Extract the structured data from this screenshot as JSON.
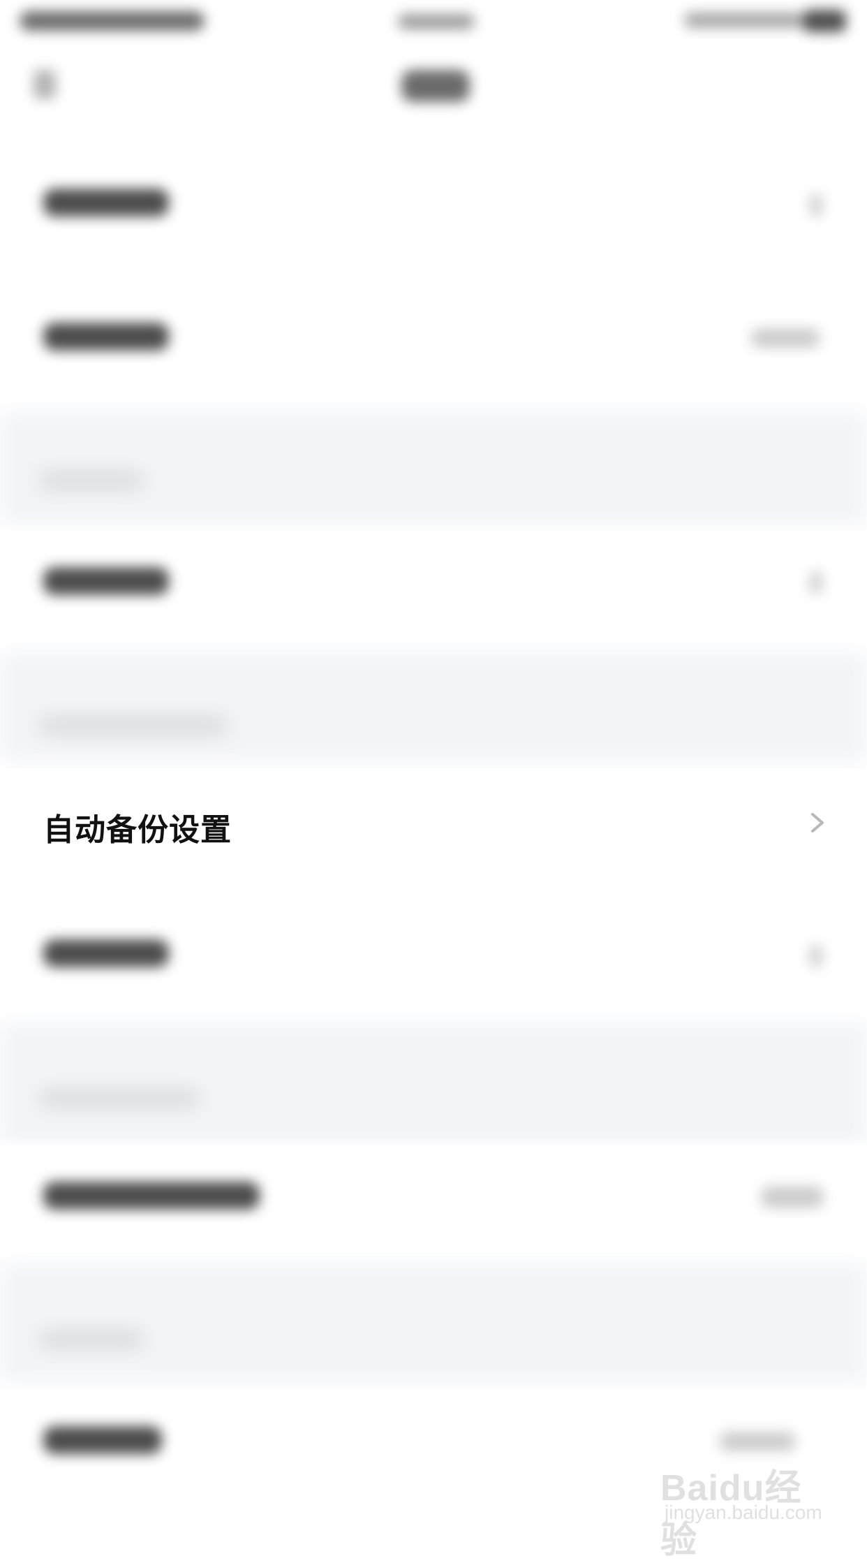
{
  "settings": {
    "focused_item": {
      "label": "自动备份设置",
      "icon": "chevron-right-icon"
    }
  },
  "watermark": {
    "brand": "Baidu经验",
    "url": "jingyan.baidu.com"
  },
  "colors": {
    "background": "#ffffff",
    "section_separator": "#f3f4f8",
    "focused_text": "#111111",
    "chevron": "#b8b8b8"
  }
}
